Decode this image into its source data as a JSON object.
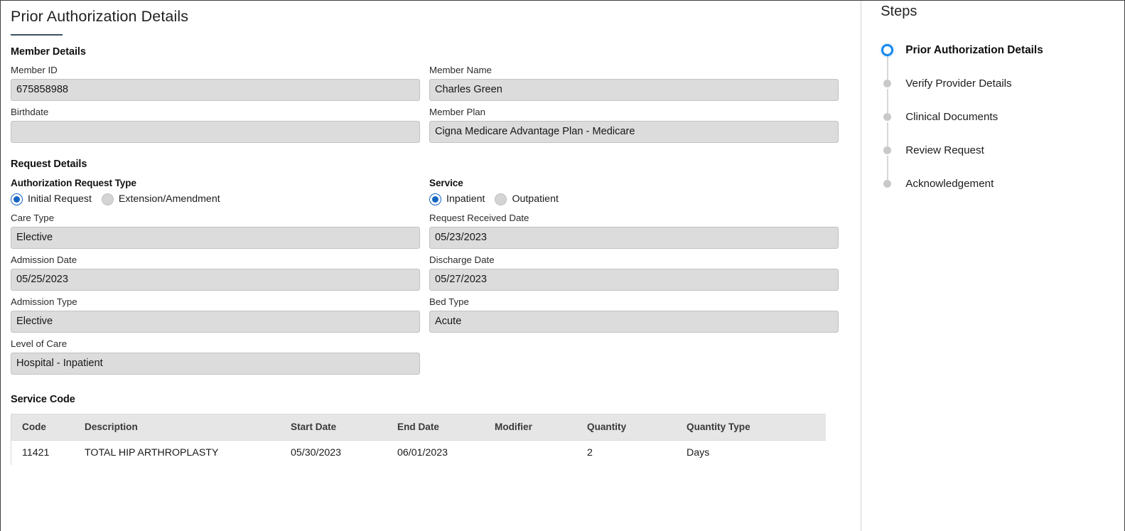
{
  "header": {
    "title": "Prior Authorization Details",
    "accent_color": "#3b5260"
  },
  "member_details": {
    "heading": "Member Details",
    "fields": [
      {
        "label": "Member ID",
        "value": "675858988"
      },
      {
        "label": "Member Name",
        "value": "Charles Green"
      },
      {
        "label": "Birthdate",
        "value": ""
      },
      {
        "label": "Member Plan",
        "value": "Cigna Medicare Advantage Plan - Medicare"
      }
    ]
  },
  "request_details": {
    "heading": "Request Details",
    "auth_request_type": {
      "label": "Authorization Request Type",
      "options": [
        {
          "label": "Initial Request",
          "selected": true
        },
        {
          "label": "Extension/Amendment",
          "selected": false
        }
      ]
    },
    "service": {
      "label": "Service",
      "options": [
        {
          "label": "Inpatient",
          "selected": true
        },
        {
          "label": "Outpatient",
          "selected": false
        }
      ]
    },
    "fields": [
      {
        "label": "Care Type",
        "value": "Elective"
      },
      {
        "label": "Request Received Date",
        "value": "05/23/2023"
      },
      {
        "label": "Admission Date",
        "value": "05/25/2023"
      },
      {
        "label": "Discharge Date",
        "value": "05/27/2023"
      },
      {
        "label": "Admission Type",
        "value": "Elective"
      },
      {
        "label": "Bed Type",
        "value": "Acute"
      },
      {
        "label": "Level of Care",
        "value": "Hospital - Inpatient"
      }
    ]
  },
  "service_code": {
    "heading": "Service Code",
    "columns": [
      "Code",
      "Description",
      "Start Date",
      "End Date",
      "Modifier",
      "Quantity",
      "Quantity Type"
    ],
    "rows": [
      {
        "code": "11421",
        "description": "TOTAL HIP ARTHROPLASTY",
        "start_date": "05/30/2023",
        "end_date": "06/01/2023",
        "modifier": "",
        "quantity": "2",
        "quantity_type": "Days"
      }
    ]
  },
  "steps": {
    "title": "Steps",
    "active_color": "#1589ee",
    "items": [
      {
        "label": "Prior Authorization Details",
        "state": "current"
      },
      {
        "label": "Verify Provider Details",
        "state": "pending"
      },
      {
        "label": "Clinical Documents",
        "state": "pending"
      },
      {
        "label": "Review Request",
        "state": "pending"
      },
      {
        "label": "Acknowledgement",
        "state": "pending"
      }
    ]
  }
}
